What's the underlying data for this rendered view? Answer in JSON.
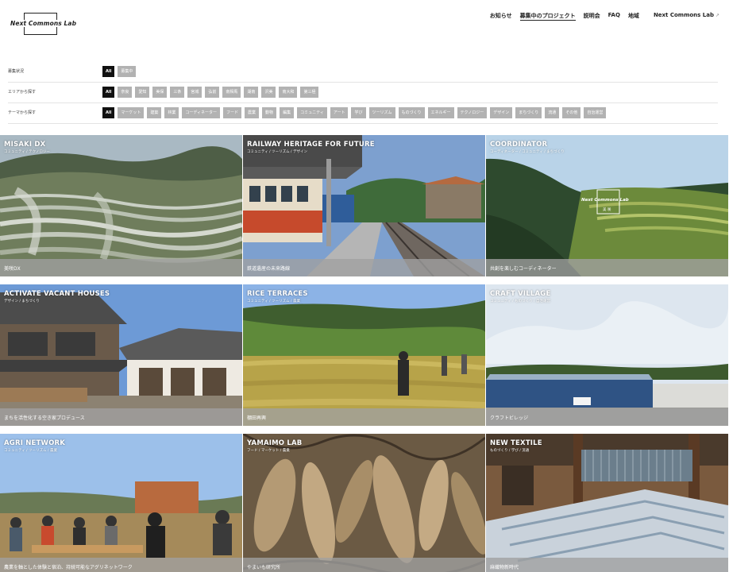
{
  "header": {
    "logo_text": "Next Commons Lab",
    "nav": [
      "お知らせ",
      "募集中のプロジェクト",
      "説明会",
      "FAQ",
      "地域"
    ],
    "external_link": "Next Commons Lab",
    "external_icon": "↗"
  },
  "filters": {
    "status": {
      "label": "募集状況",
      "tags": [
        "All",
        "募集中"
      ]
    },
    "area": {
      "label": "エリアから探す",
      "tags": [
        "All",
        "奈良",
        "愛知",
        "美保",
        "三条",
        "宮城",
        "弘前",
        "南相馬",
        "湖南",
        "沢美",
        "南大和",
        "第三極"
      ]
    },
    "theme": {
      "label": "テーマから探す",
      "tags": [
        "All",
        "マーケット",
        "建築",
        "林業",
        "コーディネーター",
        "フード",
        "農業",
        "動物",
        "編集",
        "コミュニティ",
        "アート",
        "学び",
        "ツーリズム",
        "ものづくり",
        "エネルギー",
        "テクノロジー",
        "デザイン",
        "まちづくり",
        "流通",
        "その他",
        "自治運営"
      ]
    }
  },
  "projects": [
    {
      "title": "MISAKI DX",
      "tags": "コミュニティ / テクノロジー",
      "caption": "美咲DX"
    },
    {
      "title": "RAILWAY HERITAGE FOR FUTURE",
      "tags": "コミュニティ / ツーリズム / デザイン",
      "caption": "鉄道遺産の未来路線"
    },
    {
      "title": "COORDINATOR",
      "tags": "コーディネーター / コミュニティ / まちづくり",
      "caption": "共創を楽しむコーディネーター",
      "stamp_text": "Next Commons Lab",
      "stamp_sub": "美 咲"
    },
    {
      "title": "ACTIVATE VACANT HOUSES",
      "tags": "デザイン / まちづくり",
      "caption": "まちを活性化する空き家プロデュース"
    },
    {
      "title": "RICE TERRACES",
      "tags": "コミュニティ / ツーリズム / 農業",
      "caption": "棚田再興"
    },
    {
      "title": "CRAFT VILLAGE",
      "tags": "コミュニティ / ものづくり / 自治運営",
      "caption": "クラフトビレッジ"
    },
    {
      "title": "AGRI NETWORK",
      "tags": "コミュニティ / ツーリズム / 農業",
      "caption": "農業を軸とした体験と宿泊、持続可能なアグリネットワーク"
    },
    {
      "title": "YAMAIMO LAB",
      "tags": "フード / マーケット / 農業",
      "caption": "やまいも研究所"
    },
    {
      "title": "NEW TEXTILE",
      "tags": "ものづくり / 学び / 流通",
      "caption": "麻織物新時代"
    }
  ]
}
